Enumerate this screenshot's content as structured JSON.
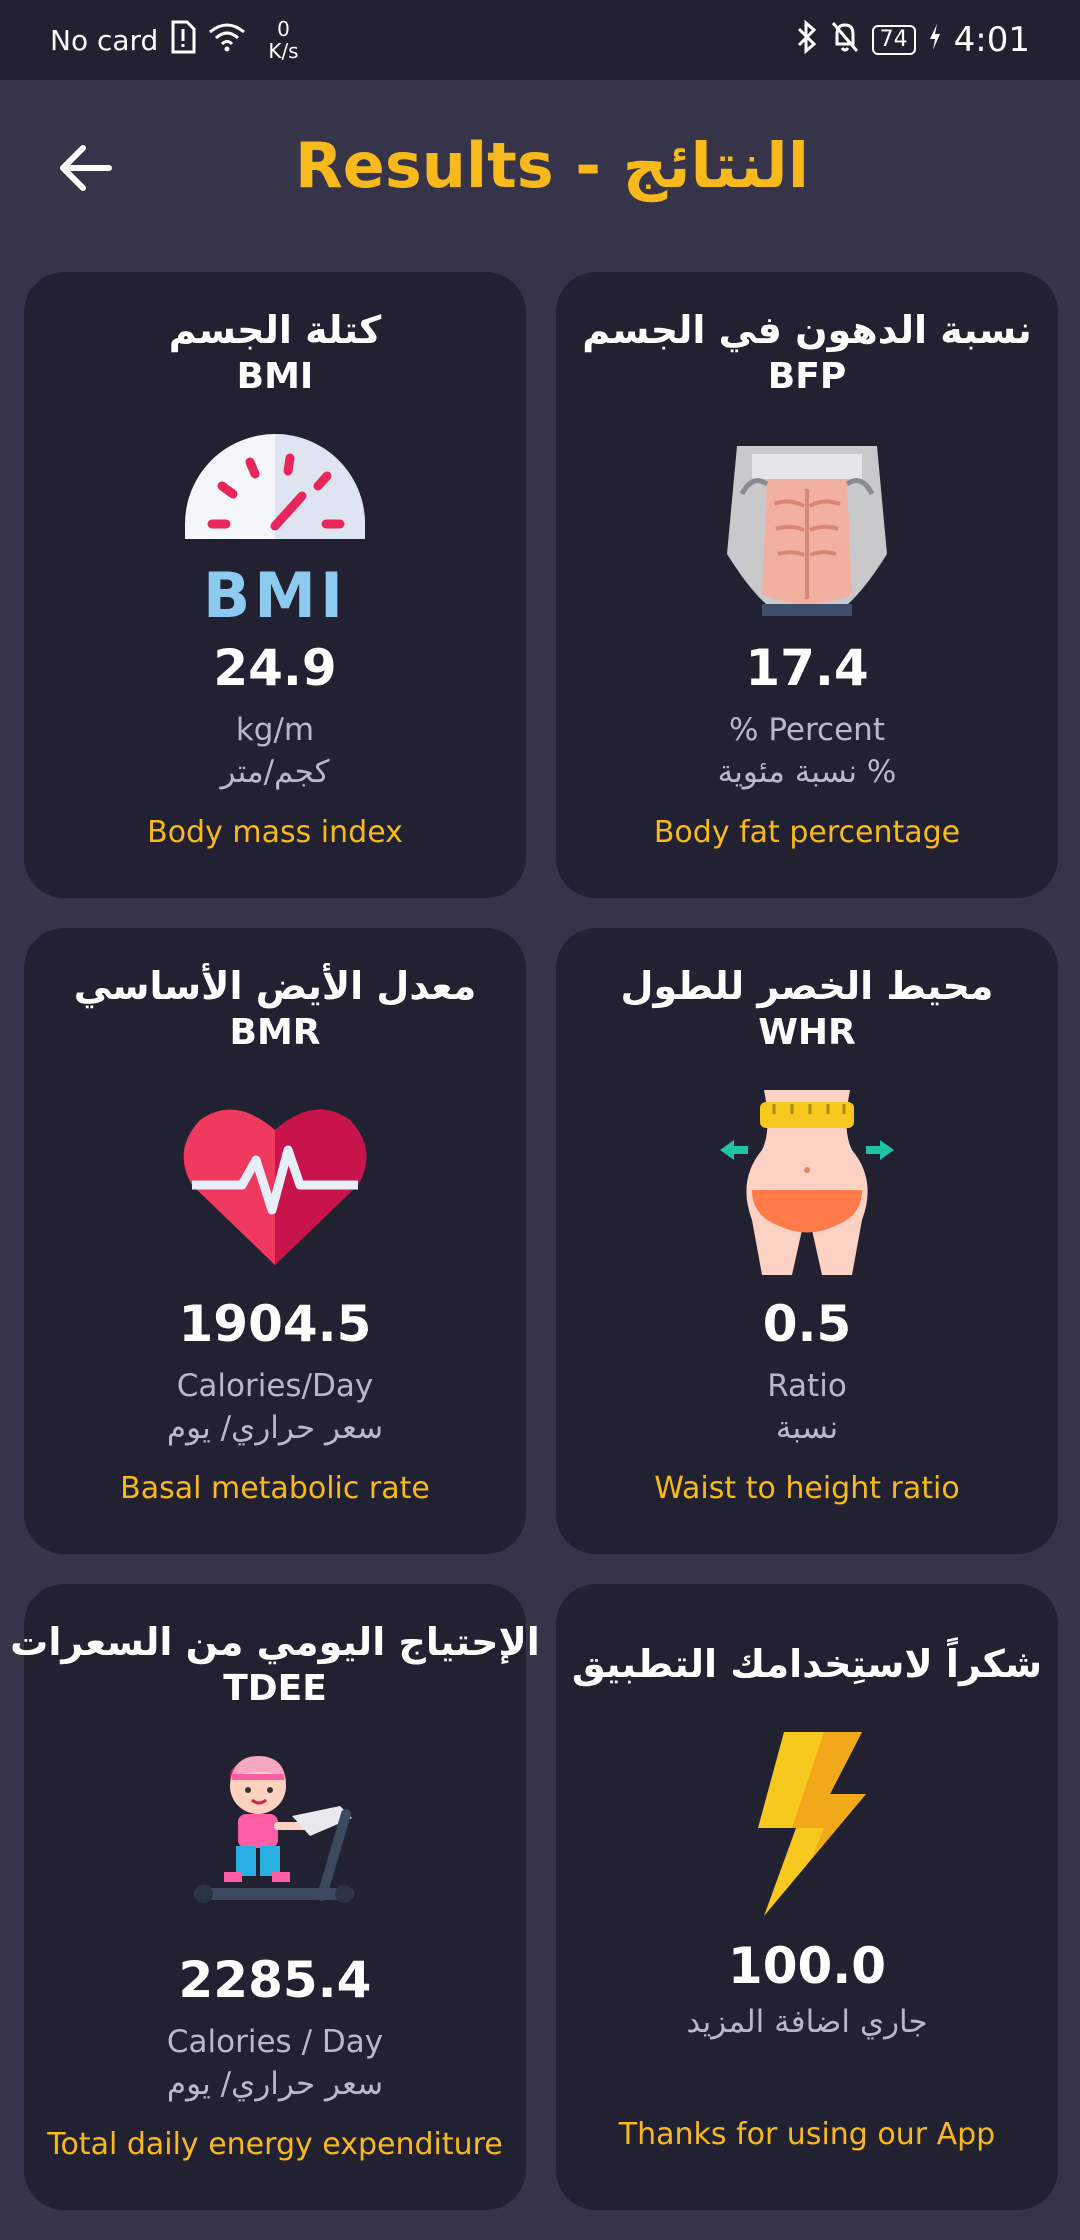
{
  "status_bar": {
    "carrier": "No card",
    "speed_value": "0",
    "speed_unit": "K/s",
    "battery": "74",
    "time": "4:01"
  },
  "header": {
    "title": "Results - النتائج",
    "back_icon": "arrow-left-icon"
  },
  "cards": [
    {
      "title_ar": "كتلة الجسم",
      "title_en": "BMI",
      "icon": "bmi-gauge-icon",
      "value": "24.9",
      "unit": "kg/m",
      "unit_ar": "كجم/متر",
      "description": "Body mass index"
    },
    {
      "title_ar": "نسبة الدهون في الجسم",
      "title_en": "BFP",
      "icon": "abdominal-muscles-icon",
      "value": "17.4",
      "unit": "% Percent",
      "unit_ar": "نسبة مئوية %",
      "description": "Body fat percentage"
    },
    {
      "title_ar": "معدل الأيض الأساسي",
      "title_en": "BMR",
      "icon": "heartbeat-icon",
      "value": "1904.5",
      "unit": "Calories/Day",
      "unit_ar": "سعر حراري/ يوم",
      "description": "Basal metabolic rate"
    },
    {
      "title_ar": "محيط الخصر للطول",
      "title_en": "WHR",
      "icon": "waist-measure-icon",
      "value": "0.5",
      "unit": "Ratio",
      "unit_ar": "نسبة",
      "description": "Waist to height ratio"
    },
    {
      "title_ar": "الإحتياج اليومي من السعرات",
      "title_en": "TDEE",
      "icon": "treadmill-girl-icon",
      "value": "2285.4",
      "unit": "Calories / Day",
      "unit_ar": "سعر حراري/ يوم",
      "description": "Total daily energy expenditure"
    },
    {
      "title_ar": "شكراً لاستِخدامك التطبيق",
      "icon": "lightning-bolt-icon",
      "value": "100.0",
      "unit": "جاري اضافة المزيد",
      "description": "Thanks for using our App"
    }
  ],
  "colors": {
    "background": "#363449",
    "card": "#222132",
    "accent": "#f7b91c",
    "muted_text": "#b9b8c6"
  }
}
